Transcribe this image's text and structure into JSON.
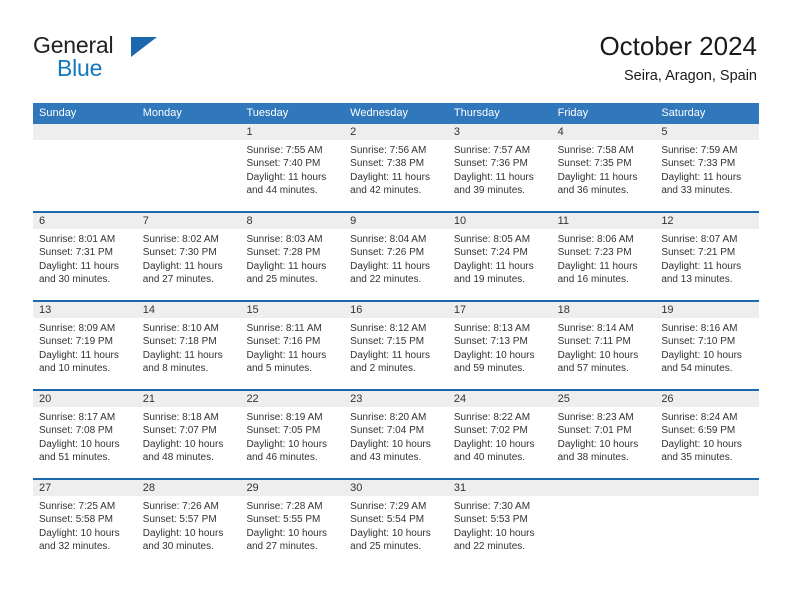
{
  "brand": {
    "name_part1": "General",
    "name_part2": "Blue",
    "logo_icon": "triangle-logo-icon"
  },
  "header": {
    "title": "October 2024",
    "subtitle": "Seira, Aragon, Spain"
  },
  "colors": {
    "header_blue": "#3077bc",
    "divider_blue": "#1b68ae",
    "date_band_gray": "#eeeeee",
    "brand_blue": "#1278be",
    "text": "#333333"
  },
  "calendar": {
    "weekdays": [
      "Sunday",
      "Monday",
      "Tuesday",
      "Wednesday",
      "Thursday",
      "Friday",
      "Saturday"
    ],
    "weeks": [
      [
        {
          "day": "",
          "sunrise": "",
          "sunset": "",
          "daylight_line1": "",
          "daylight_line2": ""
        },
        {
          "day": "",
          "sunrise": "",
          "sunset": "",
          "daylight_line1": "",
          "daylight_line2": ""
        },
        {
          "day": "1",
          "sunrise": "Sunrise: 7:55 AM",
          "sunset": "Sunset: 7:40 PM",
          "daylight_line1": "Daylight: 11 hours",
          "daylight_line2": "and 44 minutes."
        },
        {
          "day": "2",
          "sunrise": "Sunrise: 7:56 AM",
          "sunset": "Sunset: 7:38 PM",
          "daylight_line1": "Daylight: 11 hours",
          "daylight_line2": "and 42 minutes."
        },
        {
          "day": "3",
          "sunrise": "Sunrise: 7:57 AM",
          "sunset": "Sunset: 7:36 PM",
          "daylight_line1": "Daylight: 11 hours",
          "daylight_line2": "and 39 minutes."
        },
        {
          "day": "4",
          "sunrise": "Sunrise: 7:58 AM",
          "sunset": "Sunset: 7:35 PM",
          "daylight_line1": "Daylight: 11 hours",
          "daylight_line2": "and 36 minutes."
        },
        {
          "day": "5",
          "sunrise": "Sunrise: 7:59 AM",
          "sunset": "Sunset: 7:33 PM",
          "daylight_line1": "Daylight: 11 hours",
          "daylight_line2": "and 33 minutes."
        }
      ],
      [
        {
          "day": "6",
          "sunrise": "Sunrise: 8:01 AM",
          "sunset": "Sunset: 7:31 PM",
          "daylight_line1": "Daylight: 11 hours",
          "daylight_line2": "and 30 minutes."
        },
        {
          "day": "7",
          "sunrise": "Sunrise: 8:02 AM",
          "sunset": "Sunset: 7:30 PM",
          "daylight_line1": "Daylight: 11 hours",
          "daylight_line2": "and 27 minutes."
        },
        {
          "day": "8",
          "sunrise": "Sunrise: 8:03 AM",
          "sunset": "Sunset: 7:28 PM",
          "daylight_line1": "Daylight: 11 hours",
          "daylight_line2": "and 25 minutes."
        },
        {
          "day": "9",
          "sunrise": "Sunrise: 8:04 AM",
          "sunset": "Sunset: 7:26 PM",
          "daylight_line1": "Daylight: 11 hours",
          "daylight_line2": "and 22 minutes."
        },
        {
          "day": "10",
          "sunrise": "Sunrise: 8:05 AM",
          "sunset": "Sunset: 7:24 PM",
          "daylight_line1": "Daylight: 11 hours",
          "daylight_line2": "and 19 minutes."
        },
        {
          "day": "11",
          "sunrise": "Sunrise: 8:06 AM",
          "sunset": "Sunset: 7:23 PM",
          "daylight_line1": "Daylight: 11 hours",
          "daylight_line2": "and 16 minutes."
        },
        {
          "day": "12",
          "sunrise": "Sunrise: 8:07 AM",
          "sunset": "Sunset: 7:21 PM",
          "daylight_line1": "Daylight: 11 hours",
          "daylight_line2": "and 13 minutes."
        }
      ],
      [
        {
          "day": "13",
          "sunrise": "Sunrise: 8:09 AM",
          "sunset": "Sunset: 7:19 PM",
          "daylight_line1": "Daylight: 11 hours",
          "daylight_line2": "and 10 minutes."
        },
        {
          "day": "14",
          "sunrise": "Sunrise: 8:10 AM",
          "sunset": "Sunset: 7:18 PM",
          "daylight_line1": "Daylight: 11 hours",
          "daylight_line2": "and 8 minutes."
        },
        {
          "day": "15",
          "sunrise": "Sunrise: 8:11 AM",
          "sunset": "Sunset: 7:16 PM",
          "daylight_line1": "Daylight: 11 hours",
          "daylight_line2": "and 5 minutes."
        },
        {
          "day": "16",
          "sunrise": "Sunrise: 8:12 AM",
          "sunset": "Sunset: 7:15 PM",
          "daylight_line1": "Daylight: 11 hours",
          "daylight_line2": "and 2 minutes."
        },
        {
          "day": "17",
          "sunrise": "Sunrise: 8:13 AM",
          "sunset": "Sunset: 7:13 PM",
          "daylight_line1": "Daylight: 10 hours",
          "daylight_line2": "and 59 minutes."
        },
        {
          "day": "18",
          "sunrise": "Sunrise: 8:14 AM",
          "sunset": "Sunset: 7:11 PM",
          "daylight_line1": "Daylight: 10 hours",
          "daylight_line2": "and 57 minutes."
        },
        {
          "day": "19",
          "sunrise": "Sunrise: 8:16 AM",
          "sunset": "Sunset: 7:10 PM",
          "daylight_line1": "Daylight: 10 hours",
          "daylight_line2": "and 54 minutes."
        }
      ],
      [
        {
          "day": "20",
          "sunrise": "Sunrise: 8:17 AM",
          "sunset": "Sunset: 7:08 PM",
          "daylight_line1": "Daylight: 10 hours",
          "daylight_line2": "and 51 minutes."
        },
        {
          "day": "21",
          "sunrise": "Sunrise: 8:18 AM",
          "sunset": "Sunset: 7:07 PM",
          "daylight_line1": "Daylight: 10 hours",
          "daylight_line2": "and 48 minutes."
        },
        {
          "day": "22",
          "sunrise": "Sunrise: 8:19 AM",
          "sunset": "Sunset: 7:05 PM",
          "daylight_line1": "Daylight: 10 hours",
          "daylight_line2": "and 46 minutes."
        },
        {
          "day": "23",
          "sunrise": "Sunrise: 8:20 AM",
          "sunset": "Sunset: 7:04 PM",
          "daylight_line1": "Daylight: 10 hours",
          "daylight_line2": "and 43 minutes."
        },
        {
          "day": "24",
          "sunrise": "Sunrise: 8:22 AM",
          "sunset": "Sunset: 7:02 PM",
          "daylight_line1": "Daylight: 10 hours",
          "daylight_line2": "and 40 minutes."
        },
        {
          "day": "25",
          "sunrise": "Sunrise: 8:23 AM",
          "sunset": "Sunset: 7:01 PM",
          "daylight_line1": "Daylight: 10 hours",
          "daylight_line2": "and 38 minutes."
        },
        {
          "day": "26",
          "sunrise": "Sunrise: 8:24 AM",
          "sunset": "Sunset: 6:59 PM",
          "daylight_line1": "Daylight: 10 hours",
          "daylight_line2": "and 35 minutes."
        }
      ],
      [
        {
          "day": "27",
          "sunrise": "Sunrise: 7:25 AM",
          "sunset": "Sunset: 5:58 PM",
          "daylight_line1": "Daylight: 10 hours",
          "daylight_line2": "and 32 minutes."
        },
        {
          "day": "28",
          "sunrise": "Sunrise: 7:26 AM",
          "sunset": "Sunset: 5:57 PM",
          "daylight_line1": "Daylight: 10 hours",
          "daylight_line2": "and 30 minutes."
        },
        {
          "day": "29",
          "sunrise": "Sunrise: 7:28 AM",
          "sunset": "Sunset: 5:55 PM",
          "daylight_line1": "Daylight: 10 hours",
          "daylight_line2": "and 27 minutes."
        },
        {
          "day": "30",
          "sunrise": "Sunrise: 7:29 AM",
          "sunset": "Sunset: 5:54 PM",
          "daylight_line1": "Daylight: 10 hours",
          "daylight_line2": "and 25 minutes."
        },
        {
          "day": "31",
          "sunrise": "Sunrise: 7:30 AM",
          "sunset": "Sunset: 5:53 PM",
          "daylight_line1": "Daylight: 10 hours",
          "daylight_line2": "and 22 minutes."
        },
        {
          "day": "",
          "sunrise": "",
          "sunset": "",
          "daylight_line1": "",
          "daylight_line2": ""
        },
        {
          "day": "",
          "sunrise": "",
          "sunset": "",
          "daylight_line1": "",
          "daylight_line2": ""
        }
      ]
    ]
  }
}
